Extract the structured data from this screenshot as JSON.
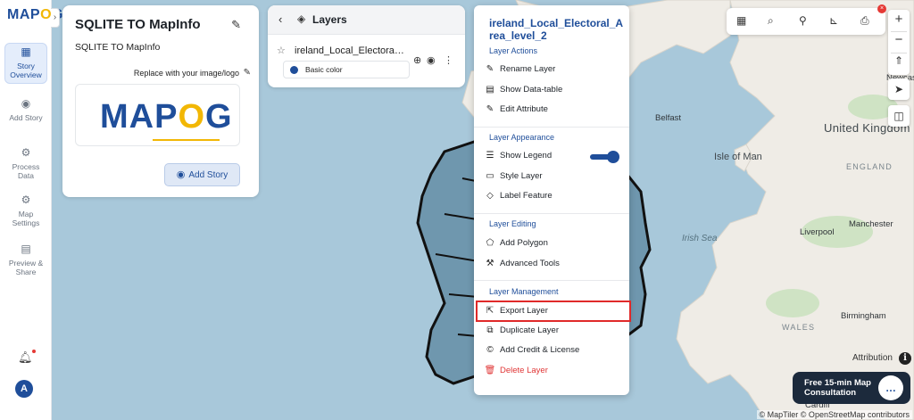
{
  "app": {
    "logo_text": "MAPOG"
  },
  "sidebar": {
    "items": [
      {
        "label": "Story Overview",
        "icon": "map-icon",
        "active": true
      },
      {
        "label": "Add Story",
        "icon": "location-pin-icon",
        "active": false
      },
      {
        "label": "Process Data",
        "icon": "gear-icon",
        "active": false
      },
      {
        "label": "Map Settings",
        "icon": "settings-icon",
        "active": false
      },
      {
        "label": "Preview & Share",
        "icon": "preview-icon",
        "active": false
      }
    ],
    "avatar_letter": "A"
  },
  "story_card": {
    "title": "SQLITE TO MapInfo",
    "subtitle": "SQLITE TO MapInfo",
    "replace_label": "Replace with your image/logo",
    "add_story_label": "Add Story"
  },
  "layers_panel": {
    "title": "Layers",
    "layer_name": "ireland_Local_Electoral_...",
    "style_label": "Basic color",
    "style_color": "#1f4e9a"
  },
  "context_menu": {
    "title": "ireland_Local_Electoral_Area_level_2",
    "sections": [
      {
        "title": "Layer Actions",
        "items": [
          "Rename Layer",
          "Show Data-table",
          "Edit Attribute"
        ]
      },
      {
        "title": "Layer Appearance",
        "items": [
          "Show Legend",
          "Style Layer",
          "Label Feature"
        ]
      },
      {
        "title": "Layer Editing",
        "items": [
          "Add Polygon",
          "Advanced Tools"
        ]
      },
      {
        "title": "Layer Management",
        "items": [
          "Export Layer",
          "Duplicate Layer",
          "Add Credit & License",
          "Delete Layer"
        ]
      }
    ],
    "show_legend_on": true,
    "highlighted_item": "Export Layer",
    "danger_color": "#e03535",
    "accent_color": "#1f4e9a"
  },
  "map": {
    "labels": {
      "belfast": "Belfast",
      "isle_of_man": "Isle of Man",
      "united_kingdom": "United Kingdom",
      "england": "ENGLAND",
      "irish_sea": "Irish Sea",
      "liverpool": "Liverpool",
      "manchester": "Manchester",
      "birmingham": "Birmingham",
      "wales": "WALES",
      "newcastle": "Newcas",
      "cardiff": "Cardiff"
    },
    "attribution": "© MapTiler © OpenStreetMap contributors",
    "attribution_label": "Attribution"
  },
  "consult_widget": {
    "text": "Free 15-min Map Consultation"
  }
}
